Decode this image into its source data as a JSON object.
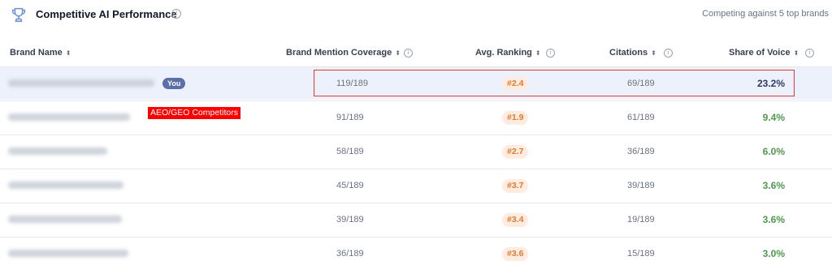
{
  "header": {
    "title": "Competitive AI Performance",
    "competing_text": "Competing against 5 top brands"
  },
  "columns": {
    "brand": "Brand Name",
    "coverage": "Brand Mention Coverage",
    "ranking": "Avg. Ranking",
    "citations": "Citations",
    "sov": "Share of Voice"
  },
  "you_badge": "You",
  "annotation": "AEO/GEO Competitors",
  "rows": [
    {
      "coverage": "119/189",
      "ranking": "#2.4",
      "citations": "69/189",
      "sov": "23.2%"
    },
    {
      "coverage": "91/189",
      "ranking": "#1.9",
      "citations": "61/189",
      "sov": "9.4%"
    },
    {
      "coverage": "58/189",
      "ranking": "#2.7",
      "citations": "36/189",
      "sov": "6.0%"
    },
    {
      "coverage": "45/189",
      "ranking": "#3.7",
      "citations": "39/189",
      "sov": "3.6%"
    },
    {
      "coverage": "39/189",
      "ranking": "#3.4",
      "citations": "19/189",
      "sov": "3.6%"
    },
    {
      "coverage": "36/189",
      "ranking": "#3.6",
      "citations": "15/189",
      "sov": "3.0%"
    }
  ],
  "colors": {
    "accent": "#5d6fa8",
    "you_row_bg": "#edf1fb",
    "rank_text": "#e07a2e",
    "rank_bg": "#fdecdf",
    "sov_green": "#4d9a4d",
    "annotation_red": "#ff0000"
  },
  "icons": {
    "title": "trophy-icon",
    "info": "info-icon",
    "sort": "sort-icon"
  }
}
